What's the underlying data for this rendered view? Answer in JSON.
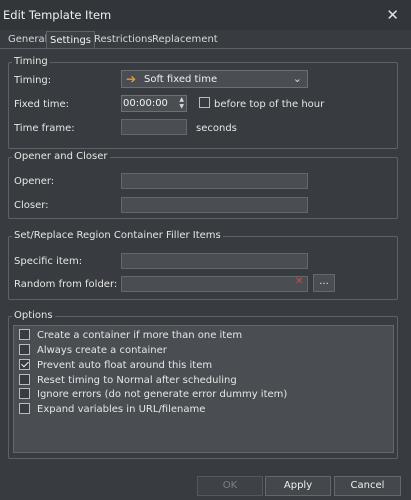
{
  "window": {
    "title": "Edit Template Item"
  },
  "tabs": [
    {
      "label": "General"
    },
    {
      "label": "Settings"
    },
    {
      "label": "Restrictions"
    },
    {
      "label": "Replacement"
    }
  ],
  "timing": {
    "group_title": "Timing",
    "timing_label": "Timing:",
    "timing_value": "Soft fixed time",
    "fixed_time_label": "Fixed time:",
    "fixed_time_value": "00:00:00",
    "before_top_label": "before top of the hour",
    "before_top_checked": false,
    "time_frame_label": "Time frame:",
    "time_frame_value": "",
    "time_frame_unit": "seconds"
  },
  "opener_closer": {
    "group_title": "Opener and Closer",
    "opener_label": "Opener:",
    "opener_value": "",
    "closer_label": "Closer:",
    "closer_value": ""
  },
  "filler": {
    "group_title": "Set/Replace Region Container Filler Items",
    "specific_label": "Specific item:",
    "specific_value": "",
    "random_label": "Random from folder:",
    "random_value": "",
    "browse_label": "..."
  },
  "options": {
    "group_title": "Options",
    "items": [
      {
        "label": "Create a container if more than one item",
        "checked": false
      },
      {
        "label": "Always create a container",
        "checked": false
      },
      {
        "label": "Prevent auto float around this item",
        "checked": true
      },
      {
        "label": "Reset timing to Normal after scheduling",
        "checked": false
      },
      {
        "label": "Ignore errors (do not generate error dummy item)",
        "checked": false
      },
      {
        "label": "Expand variables in URL/filename",
        "checked": false
      }
    ]
  },
  "buttons": {
    "ok": "OK",
    "apply": "Apply",
    "cancel": "Cancel"
  },
  "colors": {
    "background": "#383c40",
    "accent_arrow": "#e59a35",
    "clear_icon": "#d9463d"
  }
}
